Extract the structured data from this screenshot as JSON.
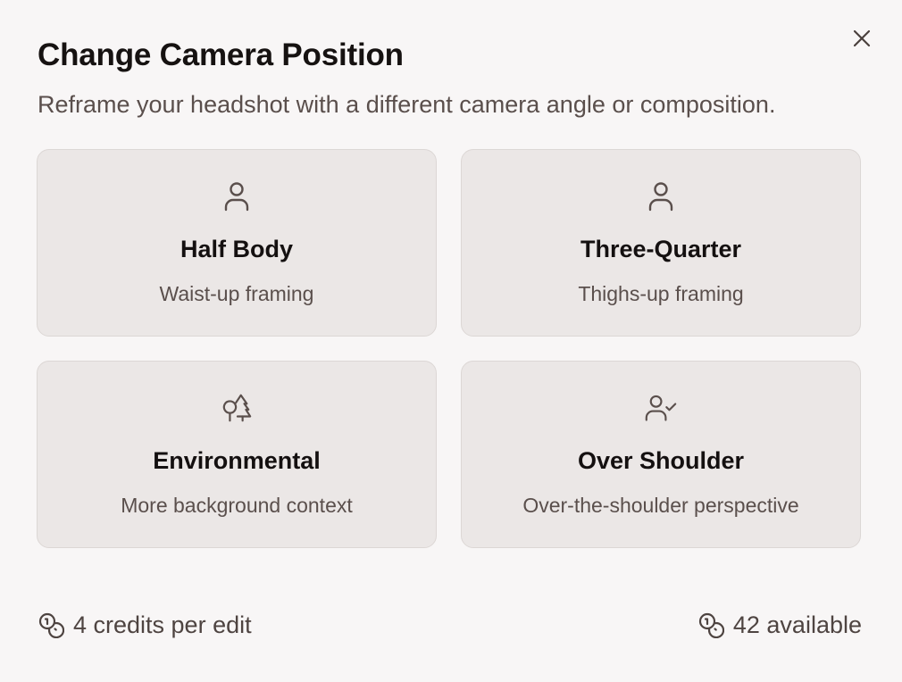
{
  "dialog": {
    "title": "Change Camera Position",
    "subtitle": "Reframe your headshot with a different camera angle or composition.",
    "close_icon": "close-icon"
  },
  "options": [
    {
      "title": "Half Body",
      "description": "Waist-up framing",
      "icon": "user-icon"
    },
    {
      "title": "Three-Quarter",
      "description": "Thighs-up framing",
      "icon": "user-icon"
    },
    {
      "title": "Environmental",
      "description": "More background context",
      "icon": "trees-icon"
    },
    {
      "title": "Over Shoulder",
      "description": "Over-the-shoulder perspective",
      "icon": "user-check-icon"
    }
  ],
  "footer": {
    "cost_label": "4 credits per edit",
    "available_label": "42 available",
    "coin_icon": "coins-icon"
  },
  "colors": {
    "background": "#f8f6f6",
    "card_background": "#ebe7e6",
    "card_border": "#dcd7d5",
    "icon_stroke": "#5a4f4c",
    "title_text": "#161211",
    "muted_text": "#5a4f4c"
  }
}
